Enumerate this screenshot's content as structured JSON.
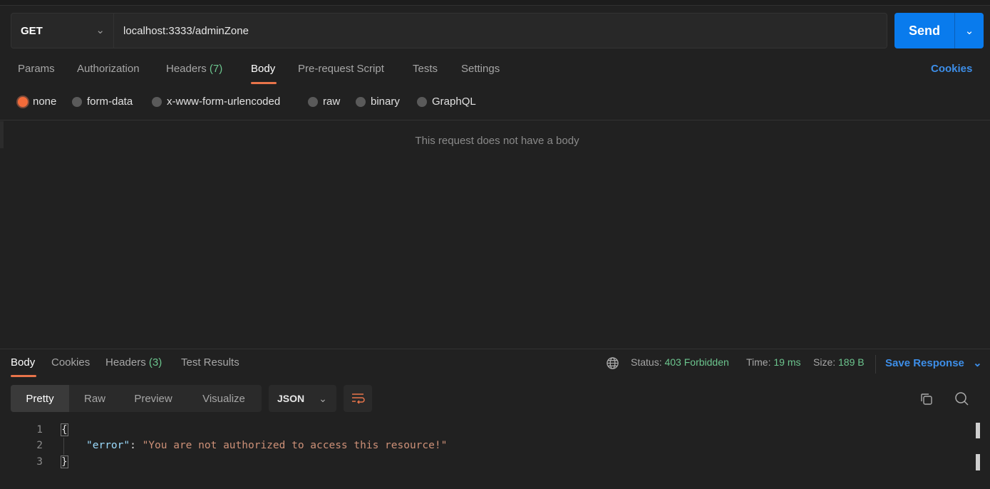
{
  "request": {
    "method": "GET",
    "url": "localhost:3333/adminZone",
    "send_label": "Send"
  },
  "request_tabs": [
    {
      "label": "Params"
    },
    {
      "label": "Authorization"
    },
    {
      "label": "Headers",
      "count": "(7)"
    },
    {
      "label": "Body"
    },
    {
      "label": "Pre-request Script"
    },
    {
      "label": "Tests"
    },
    {
      "label": "Settings"
    }
  ],
  "cookies_label": "Cookies",
  "body_types": [
    "none",
    "form-data",
    "x-www-form-urlencoded",
    "raw",
    "binary",
    "GraphQL"
  ],
  "body_empty_message": "This request does not have a body",
  "response": {
    "tabs": [
      {
        "label": "Body"
      },
      {
        "label": "Cookies"
      },
      {
        "label": "Headers",
        "count": "(3)"
      },
      {
        "label": "Test Results"
      }
    ],
    "status_label": "Status:",
    "status": "403 Forbidden",
    "time_label": "Time:",
    "time": "19 ms",
    "size_label": "Size:",
    "size": "189 B",
    "save_response": "Save Response",
    "views": [
      "Pretty",
      "Raw",
      "Preview",
      "Visualize"
    ],
    "format": "JSON",
    "lines": [
      "1",
      "2",
      "3"
    ],
    "code": {
      "open": "{",
      "key": "\"error\"",
      "colon": ": ",
      "value": "\"You are not authorized to access this resource!\"",
      "close": "}"
    }
  },
  "colors": {
    "accent": "#e8744a",
    "send": "#097bed",
    "green": "#6cc58e",
    "link": "#3d8ee8"
  }
}
